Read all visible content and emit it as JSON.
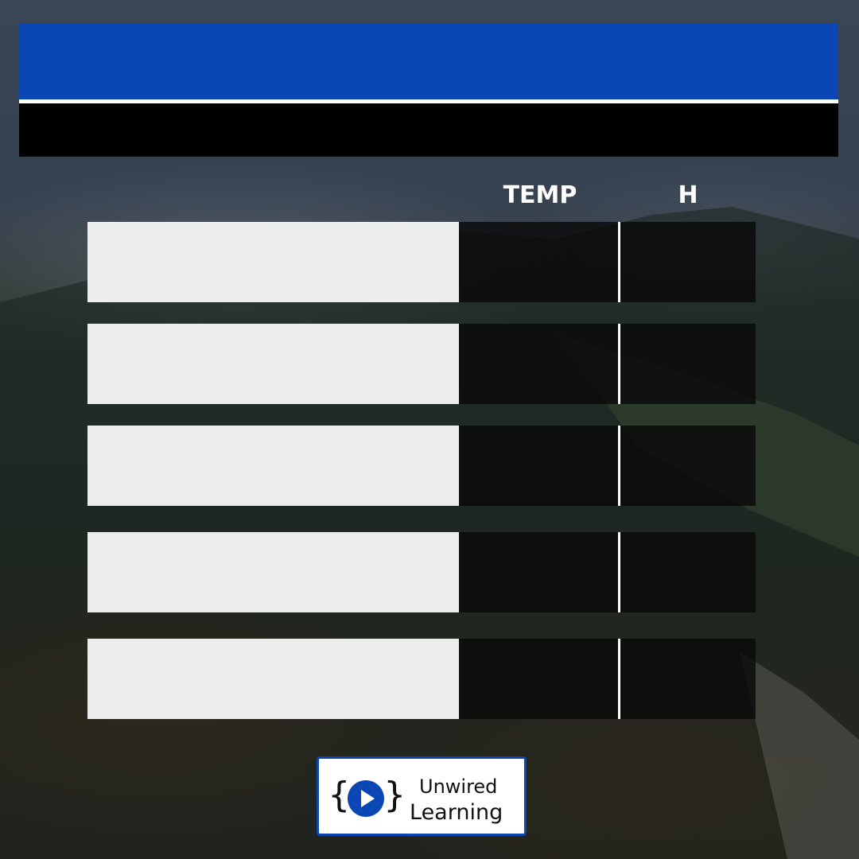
{
  "table": {
    "columns": {
      "temp": "TEMP",
      "h": "H"
    },
    "rows": [
      {
        "name": "",
        "temp": "",
        "h": ""
      },
      {
        "name": "",
        "temp": "",
        "h": ""
      },
      {
        "name": "",
        "temp": "",
        "h": ""
      },
      {
        "name": "",
        "temp": "",
        "h": ""
      },
      {
        "name": "",
        "temp": "",
        "h": ""
      }
    ]
  },
  "logo": {
    "line1": "Unwired",
    "line2": "Learning",
    "brace_left": "{",
    "brace_right": "}",
    "icon": "play-icon"
  },
  "colors": {
    "header_blue": "#0a47b4",
    "header_black": "#000000"
  }
}
